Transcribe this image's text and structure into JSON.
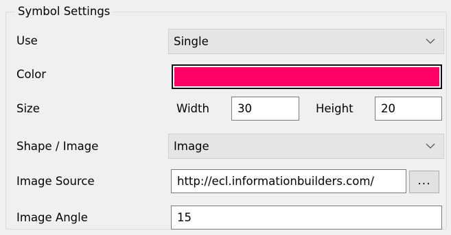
{
  "group": {
    "title": "Symbol Settings"
  },
  "rows": {
    "use": {
      "label": "Use",
      "value": "Single"
    },
    "color": {
      "label": "Color",
      "swatch": "#ff0066"
    },
    "size": {
      "label": "Size",
      "width_label": "Width",
      "width_value": "30",
      "height_label": "Height",
      "height_value": "20"
    },
    "shape": {
      "label": "Shape / Image",
      "value": "Image"
    },
    "image_source": {
      "label": "Image Source",
      "value": "http://ecl.informationbuilders.com/",
      "browse_label": "..."
    },
    "image_angle": {
      "label": "Image Angle",
      "value": "15"
    }
  }
}
